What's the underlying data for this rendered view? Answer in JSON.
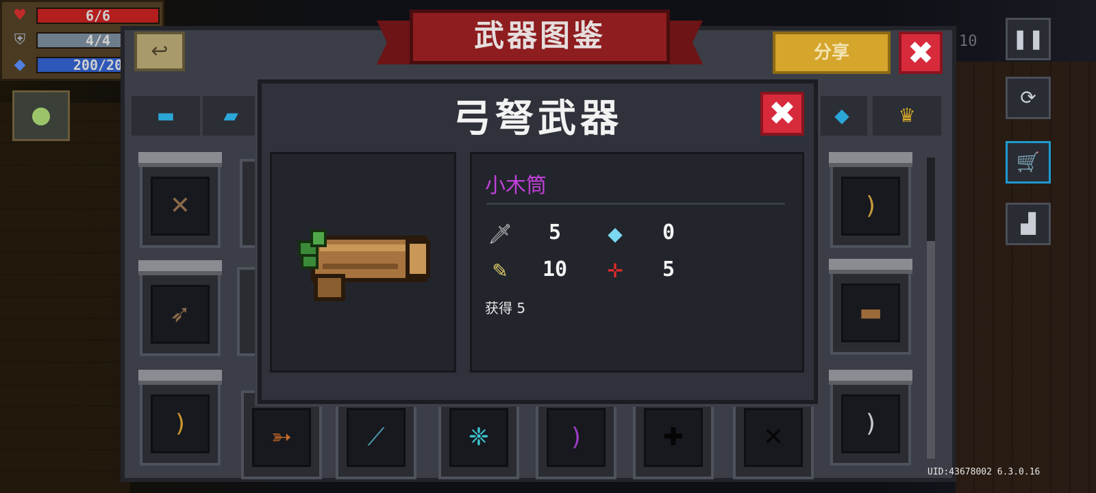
{
  "hud": {
    "hp": "6/6",
    "armor": "4/4",
    "energy": "200/20",
    "hp_icon": "heart-icon",
    "armor_icon": "shield-icon",
    "energy_icon": "diamond-icon"
  },
  "codex": {
    "title": "武器图鉴",
    "share_label": "分享",
    "close_glyph": "✖",
    "back_glyph": "↩",
    "score_fragment": "10",
    "categories": [
      {
        "name": "pistol-icon",
        "glyph": "▬",
        "color": "#2ba6d9"
      },
      {
        "name": "rifle-icon",
        "glyph": "▰",
        "color": "#2ba6d9"
      },
      {
        "name": "fish-icon",
        "glyph": "◆",
        "color": "#2ba6d9"
      },
      {
        "name": "crown-icon",
        "glyph": "♛",
        "color": "#d4a92a"
      }
    ]
  },
  "modal": {
    "title": "弓弩武器",
    "close_glyph": "✖",
    "weapon_name": "小木筒",
    "stats": {
      "damage": "5",
      "energy_cost": "0",
      "crit": "10",
      "accuracy": "5"
    },
    "stat_icons": {
      "damage": "sword-icon",
      "energy_cost": "crystal-icon",
      "crit": "feather-icon",
      "accuracy": "crosshair-icon"
    },
    "obtain_text": "获得 5"
  },
  "uid": "UID:43678002 6.3.0.16"
}
